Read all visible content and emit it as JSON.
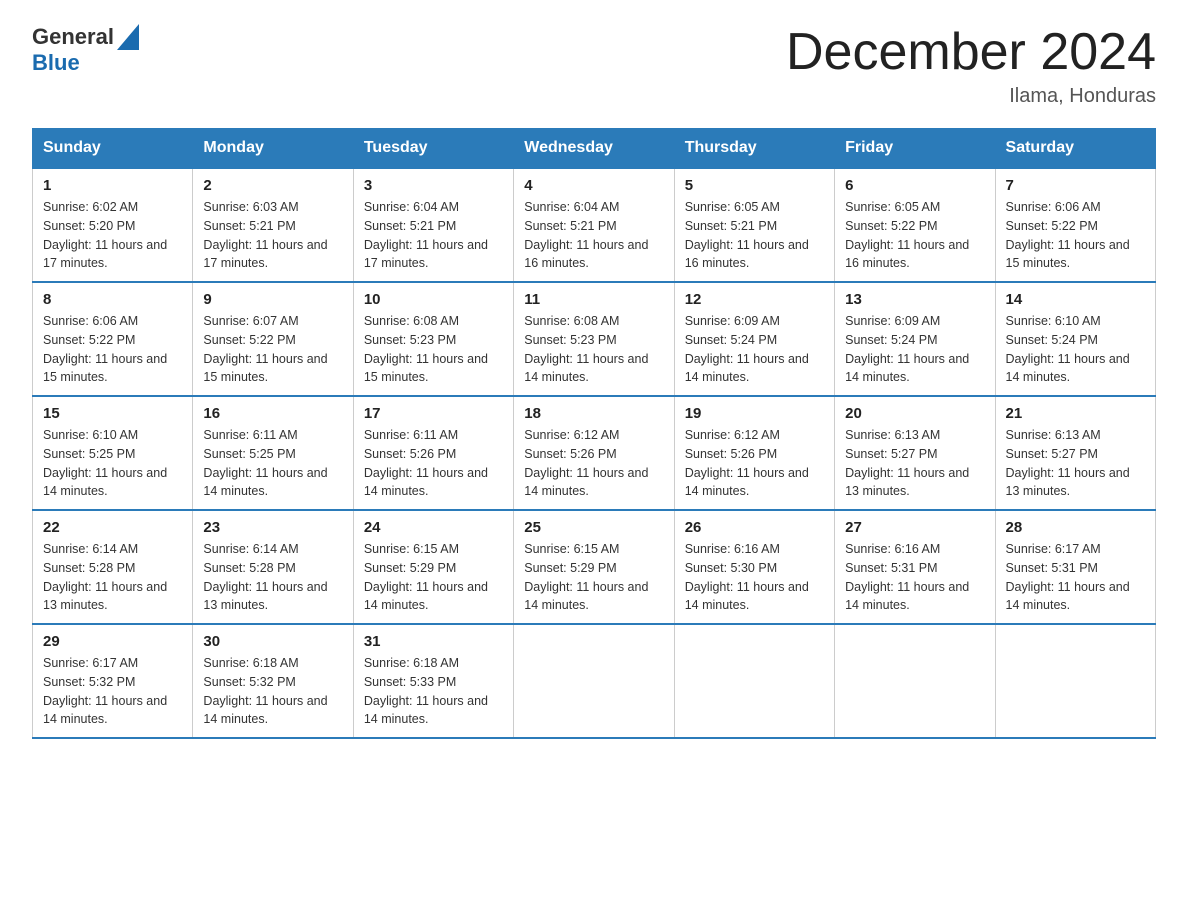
{
  "header": {
    "logo_general": "General",
    "logo_blue": "Blue",
    "title": "December 2024",
    "location": "Ilama, Honduras"
  },
  "days_of_week": [
    "Sunday",
    "Monday",
    "Tuesday",
    "Wednesday",
    "Thursday",
    "Friday",
    "Saturday"
  ],
  "weeks": [
    [
      {
        "day": "1",
        "sunrise": "6:02 AM",
        "sunset": "5:20 PM",
        "daylight": "11 hours and 17 minutes."
      },
      {
        "day": "2",
        "sunrise": "6:03 AM",
        "sunset": "5:21 PM",
        "daylight": "11 hours and 17 minutes."
      },
      {
        "day": "3",
        "sunrise": "6:04 AM",
        "sunset": "5:21 PM",
        "daylight": "11 hours and 17 minutes."
      },
      {
        "day": "4",
        "sunrise": "6:04 AM",
        "sunset": "5:21 PM",
        "daylight": "11 hours and 16 minutes."
      },
      {
        "day": "5",
        "sunrise": "6:05 AM",
        "sunset": "5:21 PM",
        "daylight": "11 hours and 16 minutes."
      },
      {
        "day": "6",
        "sunrise": "6:05 AM",
        "sunset": "5:22 PM",
        "daylight": "11 hours and 16 minutes."
      },
      {
        "day": "7",
        "sunrise": "6:06 AM",
        "sunset": "5:22 PM",
        "daylight": "11 hours and 15 minutes."
      }
    ],
    [
      {
        "day": "8",
        "sunrise": "6:06 AM",
        "sunset": "5:22 PM",
        "daylight": "11 hours and 15 minutes."
      },
      {
        "day": "9",
        "sunrise": "6:07 AM",
        "sunset": "5:22 PM",
        "daylight": "11 hours and 15 minutes."
      },
      {
        "day": "10",
        "sunrise": "6:08 AM",
        "sunset": "5:23 PM",
        "daylight": "11 hours and 15 minutes."
      },
      {
        "day": "11",
        "sunrise": "6:08 AM",
        "sunset": "5:23 PM",
        "daylight": "11 hours and 14 minutes."
      },
      {
        "day": "12",
        "sunrise": "6:09 AM",
        "sunset": "5:24 PM",
        "daylight": "11 hours and 14 minutes."
      },
      {
        "day": "13",
        "sunrise": "6:09 AM",
        "sunset": "5:24 PM",
        "daylight": "11 hours and 14 minutes."
      },
      {
        "day": "14",
        "sunrise": "6:10 AM",
        "sunset": "5:24 PM",
        "daylight": "11 hours and 14 minutes."
      }
    ],
    [
      {
        "day": "15",
        "sunrise": "6:10 AM",
        "sunset": "5:25 PM",
        "daylight": "11 hours and 14 minutes."
      },
      {
        "day": "16",
        "sunrise": "6:11 AM",
        "sunset": "5:25 PM",
        "daylight": "11 hours and 14 minutes."
      },
      {
        "day": "17",
        "sunrise": "6:11 AM",
        "sunset": "5:26 PM",
        "daylight": "11 hours and 14 minutes."
      },
      {
        "day": "18",
        "sunrise": "6:12 AM",
        "sunset": "5:26 PM",
        "daylight": "11 hours and 14 minutes."
      },
      {
        "day": "19",
        "sunrise": "6:12 AM",
        "sunset": "5:26 PM",
        "daylight": "11 hours and 14 minutes."
      },
      {
        "day": "20",
        "sunrise": "6:13 AM",
        "sunset": "5:27 PM",
        "daylight": "11 hours and 13 minutes."
      },
      {
        "day": "21",
        "sunrise": "6:13 AM",
        "sunset": "5:27 PM",
        "daylight": "11 hours and 13 minutes."
      }
    ],
    [
      {
        "day": "22",
        "sunrise": "6:14 AM",
        "sunset": "5:28 PM",
        "daylight": "11 hours and 13 minutes."
      },
      {
        "day": "23",
        "sunrise": "6:14 AM",
        "sunset": "5:28 PM",
        "daylight": "11 hours and 13 minutes."
      },
      {
        "day": "24",
        "sunrise": "6:15 AM",
        "sunset": "5:29 PM",
        "daylight": "11 hours and 14 minutes."
      },
      {
        "day": "25",
        "sunrise": "6:15 AM",
        "sunset": "5:29 PM",
        "daylight": "11 hours and 14 minutes."
      },
      {
        "day": "26",
        "sunrise": "6:16 AM",
        "sunset": "5:30 PM",
        "daylight": "11 hours and 14 minutes."
      },
      {
        "day": "27",
        "sunrise": "6:16 AM",
        "sunset": "5:31 PM",
        "daylight": "11 hours and 14 minutes."
      },
      {
        "day": "28",
        "sunrise": "6:17 AM",
        "sunset": "5:31 PM",
        "daylight": "11 hours and 14 minutes."
      }
    ],
    [
      {
        "day": "29",
        "sunrise": "6:17 AM",
        "sunset": "5:32 PM",
        "daylight": "11 hours and 14 minutes."
      },
      {
        "day": "30",
        "sunrise": "6:18 AM",
        "sunset": "5:32 PM",
        "daylight": "11 hours and 14 minutes."
      },
      {
        "day": "31",
        "sunrise": "6:18 AM",
        "sunset": "5:33 PM",
        "daylight": "11 hours and 14 minutes."
      },
      null,
      null,
      null,
      null
    ]
  ]
}
